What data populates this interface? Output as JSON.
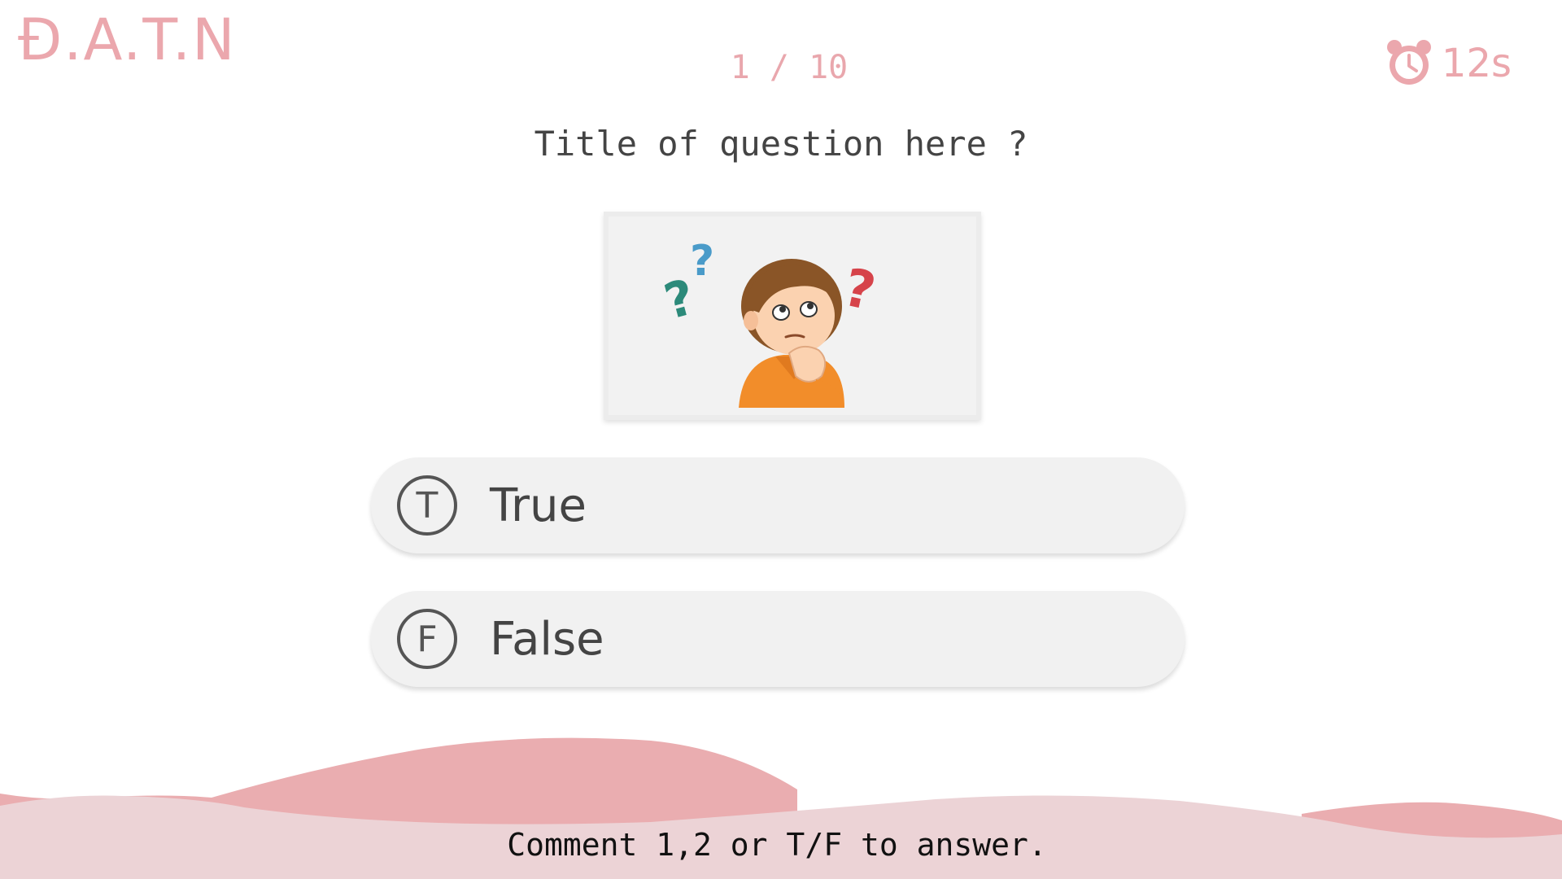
{
  "app": {
    "logo": "Đ.A.T.N"
  },
  "header": {
    "progress": "1 / 10",
    "timer": "12s",
    "timer_icon": "alarm-clock-icon"
  },
  "question": {
    "title": "Title of question here ?",
    "image": "thinking-boy-illustration"
  },
  "answers": [
    {
      "key": "T",
      "label": "True"
    },
    {
      "key": "F",
      "label": "False"
    }
  ],
  "footer": {
    "instruction": "Comment 1,2 or T/F to answer."
  },
  "colors": {
    "accent": "#eba7ad",
    "wave_dark": "#eaadb0",
    "wave_light": "#ecd3d6",
    "card": "#f1f1f1",
    "text": "#444444"
  }
}
